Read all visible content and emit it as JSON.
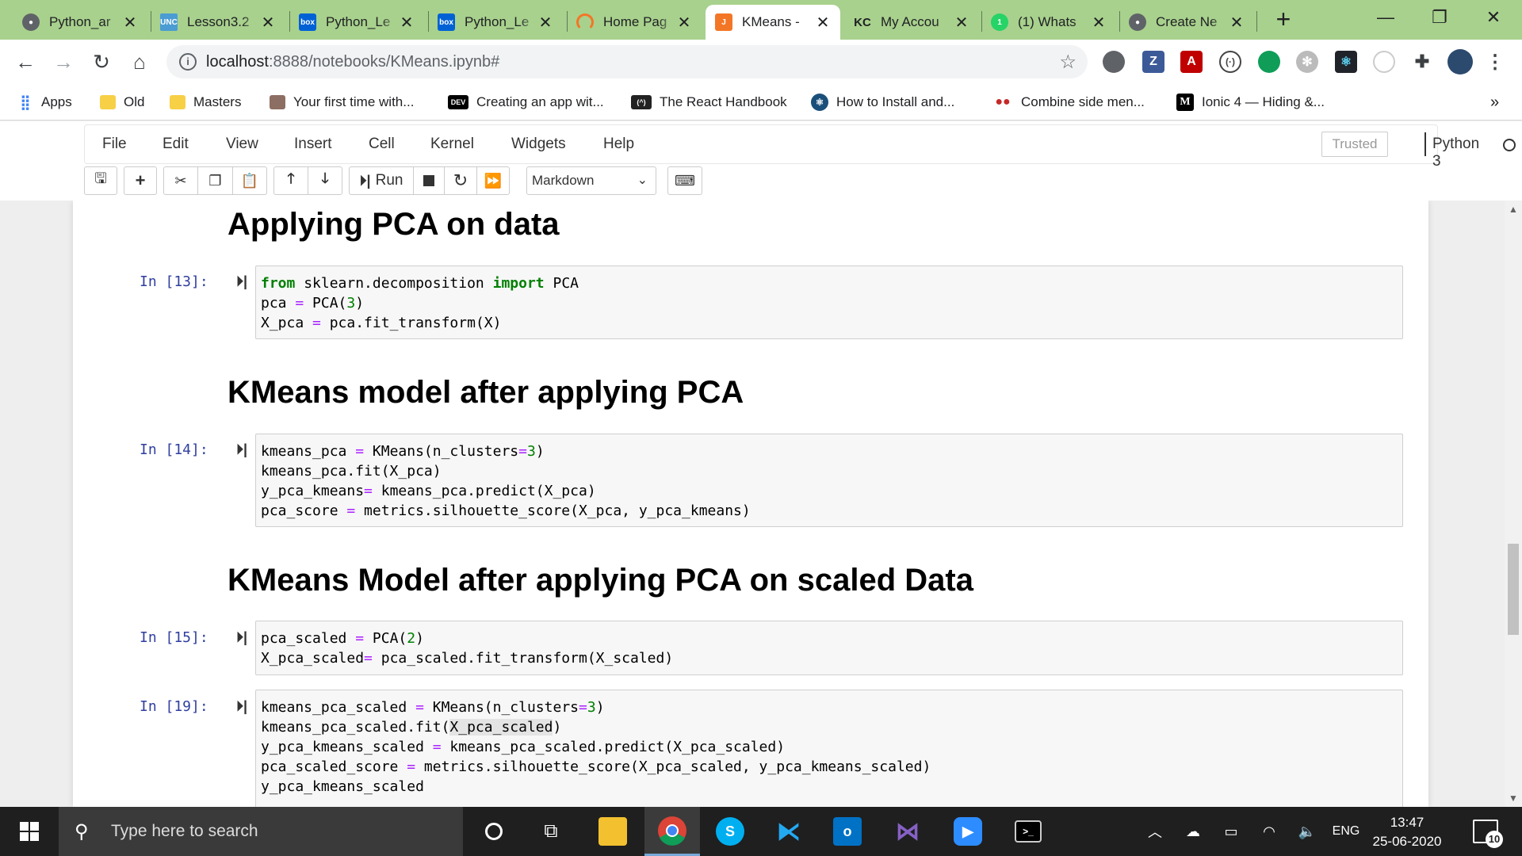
{
  "browser": {
    "tabs": [
      {
        "title": "Python_ar",
        "favicon": "github-icon",
        "color": "#5f6368"
      },
      {
        "title": "Lesson3.2",
        "favicon": "unc-icon",
        "color": "#4b9cd3"
      },
      {
        "title": "Python_Le",
        "favicon": "box-icon",
        "color": "#0061d5"
      },
      {
        "title": "Python_Le",
        "favicon": "box-icon",
        "color": "#0061d5"
      },
      {
        "title": "Home Pag",
        "favicon": "loading-icon",
        "color": "#f37626"
      },
      {
        "title": "KMeans -",
        "favicon": "jupyter-icon",
        "color": "#f37626"
      },
      {
        "title": "My Accou",
        "favicon": "kc-icon",
        "color": "#202124"
      },
      {
        "title": "(1) Whats",
        "favicon": "whatsapp-icon",
        "color": "#25d366"
      },
      {
        "title": "Create Ne",
        "favicon": "github-icon",
        "color": "#5f6368"
      }
    ],
    "active_tab_index": 5,
    "url_host": "localhost",
    "url_path": ":8888/notebooks/KMeans.ipynb#",
    "bookmarks": [
      {
        "label": "Apps",
        "icon": "apps-grid-icon"
      },
      {
        "label": "Old",
        "icon": "folder-icon"
      },
      {
        "label": "Masters",
        "icon": "folder-icon"
      },
      {
        "label": "Your first time with...",
        "icon": "page-icon"
      },
      {
        "label": "Creating an app wit...",
        "icon": "dev-icon"
      },
      {
        "label": "The React Handbook",
        "icon": "react-handbook-icon"
      },
      {
        "label": "How to Install and...",
        "icon": "react-icon"
      },
      {
        "label": "Combine side men...",
        "icon": "dots-icon"
      },
      {
        "label": "Ionic 4 — Hiding &...",
        "icon": "medium-icon"
      }
    ],
    "bookmarks_overflow": "»"
  },
  "jupyter": {
    "menu": [
      "File",
      "Edit",
      "View",
      "Insert",
      "Cell",
      "Kernel",
      "Widgets",
      "Help"
    ],
    "trusted_label": "Trusted",
    "kernel_name": "Python 3",
    "toolbar": {
      "run_label": "Run",
      "cell_type": "Markdown"
    }
  },
  "notebook": {
    "headings": [
      "Applying PCA on data",
      "KMeans model after applying PCA",
      "KMeans Model after applying PCA on scaled Data"
    ],
    "cells": [
      {
        "prompt": "In [13]:",
        "lines": [
          "from sklearn.decomposition import PCA",
          "pca = PCA(3)",
          "X_pca = pca.fit_transform(X)"
        ]
      },
      {
        "prompt": "In [14]:",
        "lines": [
          "kmeans_pca = KMeans(n_clusters=3)",
          "kmeans_pca.fit(X_pca)",
          "y_pca_kmeans= kmeans_pca.predict(X_pca)",
          "pca_score = metrics.silhouette_score(X_pca, y_pca_kmeans)"
        ]
      },
      {
        "prompt": "In [15]:",
        "lines": [
          "pca_scaled = PCA(2)",
          "X_pca_scaled= pca_scaled.fit_transform(X_scaled)"
        ]
      },
      {
        "prompt": "In [19]:",
        "lines": [
          "kmeans_pca_scaled = KMeans(n_clusters=3)",
          "kmeans_pca_scaled.fit(X_pca_scaled)",
          "y_pca_kmeans_scaled = kmeans_pca_scaled.predict(X_pca_scaled)",
          "pca_scaled_score = metrics.silhouette_score(X_pca_scaled, y_pca_kmeans_scaled)",
          "y_pca_kmeans_scaled"
        ]
      }
    ]
  },
  "taskbar": {
    "search_placeholder": "Type here to search",
    "language": "ENG",
    "time": "13:47",
    "date": "25-06-2020",
    "notification_count": "10"
  }
}
